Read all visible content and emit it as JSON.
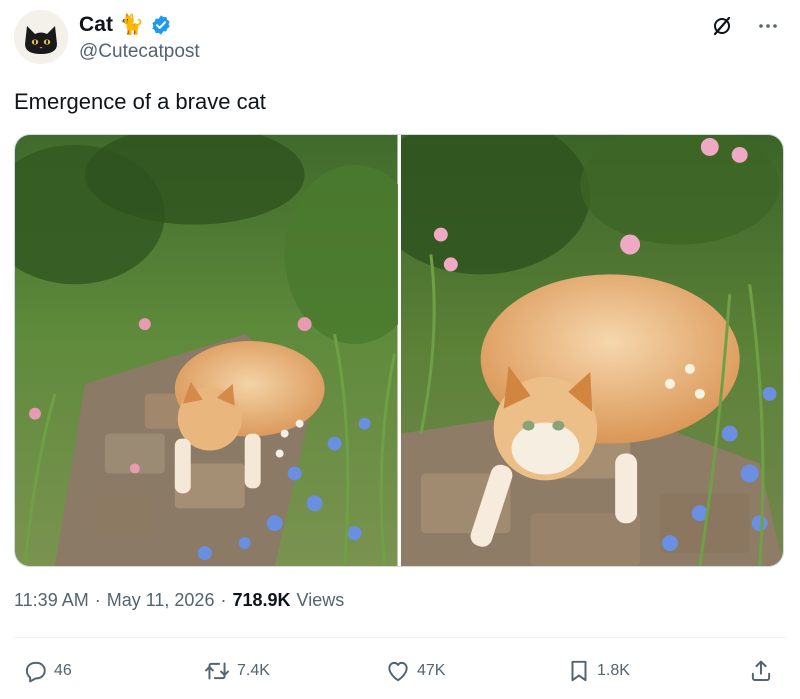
{
  "author": {
    "display_name": "Cat",
    "name_emoji": "🐈",
    "handle": "@Cutecatpost",
    "verified": true,
    "verified_color": "#1d9bf0",
    "avatar_icon": "black-cat-face-icon"
  },
  "header_actions": {
    "grok_icon": "grok-icon",
    "more_icon": "more-icon"
  },
  "tweet": {
    "text": "Emergence of a brave cat"
  },
  "media": {
    "images": [
      {
        "icon": "photo-icon",
        "subject": "cat-walking-garden-path-left"
      },
      {
        "icon": "photo-icon",
        "subject": "cat-walking-garden-path-right"
      }
    ]
  },
  "meta": {
    "time": "11:39 AM",
    "separator": "·",
    "date": "May 11, 2026",
    "views_count": "718.9K",
    "views_label": "Views"
  },
  "actions": {
    "reply": {
      "icon": "reply-icon",
      "count": "46"
    },
    "repost": {
      "icon": "repost-icon",
      "count": "7.4K"
    },
    "like": {
      "icon": "heart-icon",
      "count": "47K"
    },
    "bookmark": {
      "icon": "bookmark-icon",
      "count": "1.8K"
    },
    "share": {
      "icon": "share-icon"
    }
  },
  "colors": {
    "text_primary": "#0f1419",
    "text_secondary": "#536471",
    "border": "#cfd9de",
    "verified": "#1d9bf0"
  }
}
